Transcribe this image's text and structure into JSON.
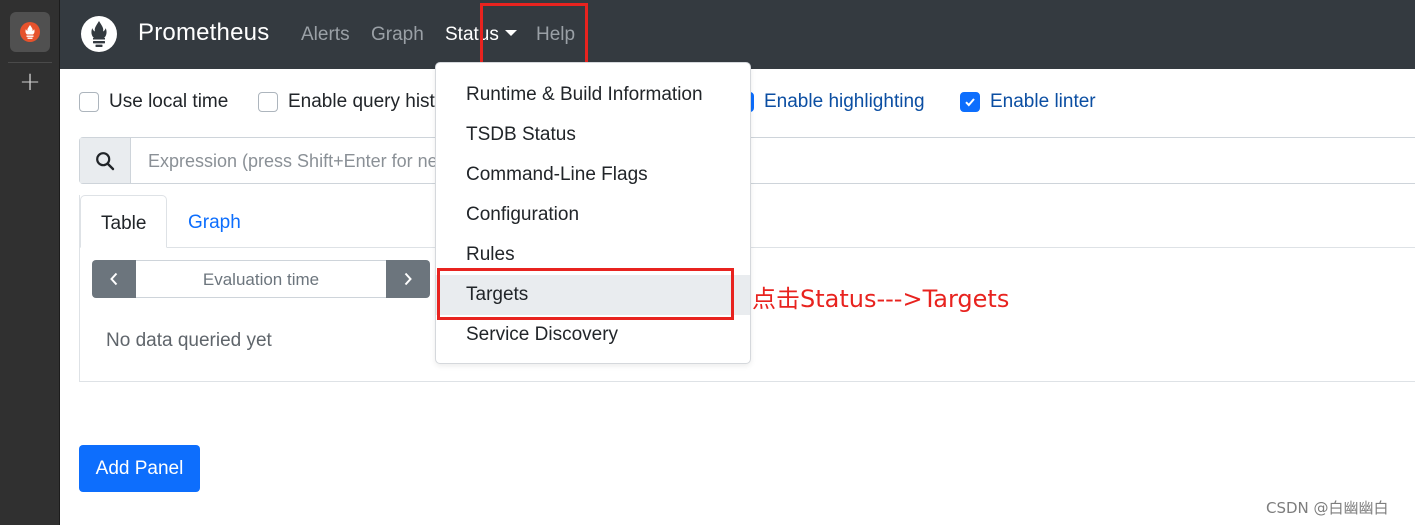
{
  "navbar": {
    "brand": "Prometheus",
    "links": {
      "alerts": "Alerts",
      "graph": "Graph",
      "status": "Status",
      "help": "Help"
    }
  },
  "options": {
    "use_local_time": {
      "label": "Use local time",
      "checked": false
    },
    "enable_query_history": {
      "label": "Enable query history",
      "checked": false
    },
    "enable_highlighting": {
      "label": "Enable highlighting",
      "checked": true
    },
    "enable_linter": {
      "label": "Enable linter",
      "checked": true
    }
  },
  "expression": {
    "placeholder": "Expression (press Shift+Enter for newlines)"
  },
  "panel": {
    "tabs": {
      "table": "Table",
      "graph": "Graph"
    },
    "evaluation_time_placeholder": "Evaluation time",
    "no_data": "No data queried yet"
  },
  "add_panel": "Add Panel",
  "status_menu": {
    "items": [
      "Runtime & Build Information",
      "TSDB Status",
      "Command-Line Flags",
      "Configuration",
      "Rules",
      "Targets",
      "Service Discovery"
    ],
    "hovered_index": 5
  },
  "annotation": "点击Status--->Targets",
  "watermark": "CSDN @白幽幽白",
  "colors": {
    "navbar": "#343a40",
    "primary": "#0d6efd",
    "annotation_red": "#e8231f"
  },
  "icons": [
    "prometheus-logo-icon",
    "plus-icon",
    "search-icon",
    "chevron-left-icon",
    "chevron-right-icon",
    "caret-down-icon",
    "check-icon"
  ]
}
